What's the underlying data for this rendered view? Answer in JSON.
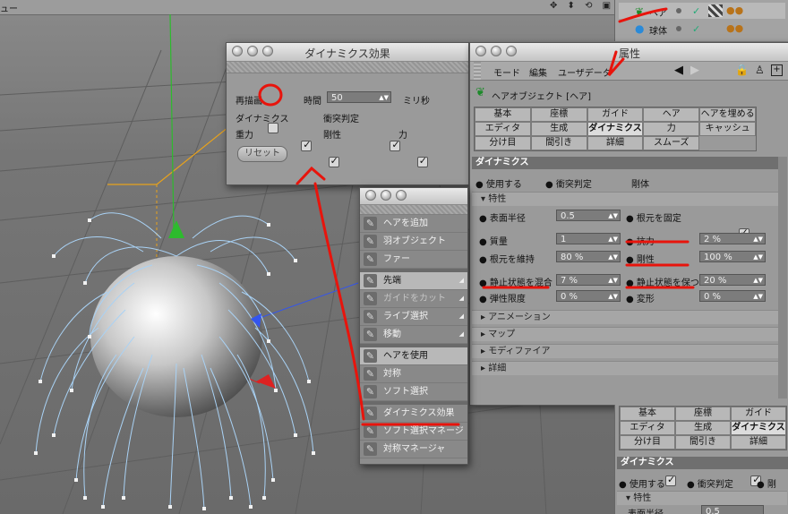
{
  "viewport": {
    "menu_label": "ュー",
    "nav_icons": "✥ ⬍ ⟲ ▣"
  },
  "object_manager": {
    "rows": [
      {
        "icon": "hair-icon",
        "name": "ヘア"
      },
      {
        "icon": "sphere-icon",
        "name": "球体"
      }
    ]
  },
  "dynamics_window": {
    "title": "ダイナミクス効果",
    "redraw_label": "再描画",
    "time_label": "時間",
    "time_value": "50",
    "time_unit": "ミリ秒",
    "dynamics_label": "ダイナミクス",
    "collision_label": "衝突判定",
    "gravity_label": "重力",
    "stiffness_label": "剛性",
    "force_label": "力",
    "reset_label": "リセット"
  },
  "attributes": {
    "title": "属性",
    "menu": [
      "モード",
      "編集",
      "ユーザデータ"
    ],
    "object_title": "ヘアオブジェクト [ヘア]",
    "tabs": [
      [
        "基本",
        "座標",
        "ガイド",
        "ヘア",
        "ヘアを埋める"
      ],
      [
        "エディタ",
        "生成",
        "ダイナミクス",
        "力",
        "キャッシュ"
      ],
      [
        "分け目",
        "間引き",
        "詳細",
        "スムーズ"
      ]
    ],
    "active_tab": "ダイナミクス",
    "section": "ダイナミクス",
    "use_label": "使用する",
    "collision_label": "衝突判定",
    "rigid_label": "剛体",
    "subsection": "特性",
    "params": {
      "surface_radius": {
        "label": "表面半径",
        "value": "0.5"
      },
      "fix_root": {
        "label": "根元を固定"
      },
      "mass": {
        "label": "質量",
        "value": "1"
      },
      "drag": {
        "label": "抗力",
        "value": "2 %"
      },
      "hold_root": {
        "label": "根元を維持",
        "value": "80 %"
      },
      "rigidity": {
        "label": "剛性",
        "value": "100 %"
      },
      "rest_mix": {
        "label": "静止状態を混合",
        "value": "7 %"
      },
      "rest_hold": {
        "label": "静止状態を保つ",
        "value": "20 %"
      },
      "elastic_limit": {
        "label": "弾性限度",
        "value": "0 %"
      },
      "deform": {
        "label": "変形",
        "value": "0 %"
      }
    },
    "groups": [
      "アニメーション",
      "マップ",
      "モディファイア",
      "詳細"
    ]
  },
  "tool_menu": {
    "items": [
      {
        "label": "ヘアを追加",
        "icon": "add-hair-icon",
        "dis": false,
        "sub": false
      },
      {
        "label": "羽オブジェクト",
        "icon": "feather-icon",
        "dis": false,
        "sub": false
      },
      {
        "label": "ファー",
        "icon": "fur-icon",
        "dis": false,
        "sub": false
      },
      {
        "sep": true
      },
      {
        "label": "先端",
        "icon": "tip-icon",
        "dis": false,
        "sub": true,
        "sel": true
      },
      {
        "label": "ガイドをカット",
        "icon": "cut-guides-icon",
        "dis": true,
        "sub": true
      },
      {
        "label": "ライブ選択",
        "icon": "live-select-icon",
        "dis": false,
        "sub": true
      },
      {
        "label": "移動",
        "icon": "move-icon",
        "dis": false,
        "sub": true
      },
      {
        "sep": true
      },
      {
        "label": "ヘアを使用",
        "icon": "use-hair-icon",
        "dis": false,
        "sub": false,
        "sel": true
      },
      {
        "label": "対称",
        "icon": "symmetry-icon",
        "dis": false,
        "sub": false
      },
      {
        "label": "ソフト選択",
        "icon": "soft-select-icon",
        "dis": false,
        "sub": false
      },
      {
        "sep": true
      },
      {
        "label": "ダイナミクス効果",
        "icon": "dynamics-effect-icon",
        "dis": false,
        "sub": false
      },
      {
        "label": "ソフト選択マネージャ",
        "icon": "soft-select-manager-icon",
        "dis": false,
        "sub": false
      },
      {
        "label": "対称マネージャ",
        "icon": "symmetry-manager-icon",
        "dis": false,
        "sub": false
      }
    ]
  },
  "lower_attributes": {
    "tabs": [
      [
        "基本",
        "座標",
        "ガイド"
      ],
      [
        "エディタ",
        "生成",
        "ダイナミクス"
      ],
      [
        "分け目",
        "間引き",
        "詳細"
      ]
    ],
    "section": "ダイナミクス",
    "use_label": "使用する",
    "collision_label": "衝突判定",
    "truncated_label": "剛",
    "subsection": "特性",
    "cut_label": "表面半径",
    "cut_value": "0.5"
  },
  "colors": {
    "annotation": "#e8140c",
    "hair": "#a9d2f5",
    "axis_green": "#2dbb2d"
  }
}
